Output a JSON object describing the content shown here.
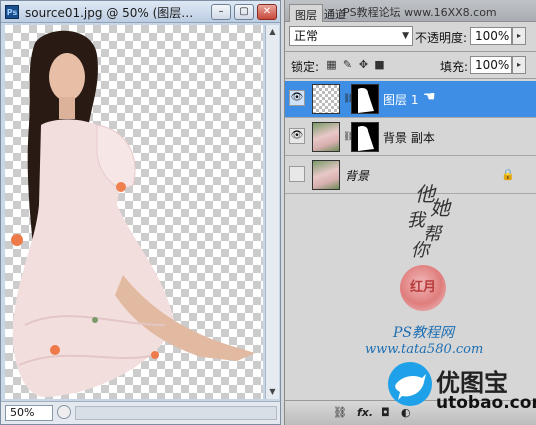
{
  "document": {
    "title": "source01.jpg @ 50% (图层…",
    "zoom": "50%",
    "minimize_label": "–",
    "restore_label": "▢",
    "close_label": "✕"
  },
  "layers_panel": {
    "tabs": [
      {
        "label": "图层"
      },
      {
        "label": "通道"
      }
    ],
    "header_watermark": "PS教程论坛 www.16XX8.com",
    "blend_mode": "正常",
    "opacity_label": "不透明度:",
    "opacity_value": "100%",
    "lock_label": "锁定:",
    "fill_label": "填充:",
    "fill_value": "100%",
    "layers": [
      {
        "name": "图层 1",
        "selected": true,
        "visible": true
      },
      {
        "name": "背景 副本",
        "selected": false,
        "visible": true
      },
      {
        "name": "背景",
        "selected": false,
        "visible": false,
        "locked": true
      }
    ],
    "watermark_sig": [
      "他",
      "她",
      "我",
      "帮",
      "你"
    ],
    "watermark_seal": "红月",
    "watermark_line1": "PS教程网",
    "watermark_line2": "www.tata580.com"
  },
  "brand": {
    "name": "优图宝",
    "url": "utobao.com",
    "color": "#1ea1e8"
  },
  "colors": {
    "selection": "#3e8ee5"
  }
}
